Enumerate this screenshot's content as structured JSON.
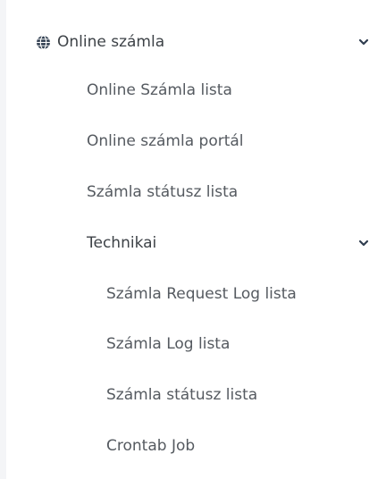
{
  "menu": {
    "title": "Online számla",
    "title_icon": "globe-icon",
    "expanded_icon": "chevron-down-icon",
    "items": [
      {
        "label": "Online Számla lista"
      },
      {
        "label": "Online számla portál"
      },
      {
        "label": "Számla státusz lista"
      }
    ],
    "group": {
      "label": "Technikai",
      "expanded_icon": "chevron-down-icon",
      "items": [
        {
          "label": "Számla Request Log lista"
        },
        {
          "label": "Számla Log lista"
        },
        {
          "label": "Számla státusz lista"
        },
        {
          "label": "Crontab Job"
        }
      ]
    }
  },
  "colors": {
    "text": "#555a60",
    "heading_text": "#3d4247",
    "icon": "#2f3d4f",
    "gutter": "#f4f5f7"
  }
}
